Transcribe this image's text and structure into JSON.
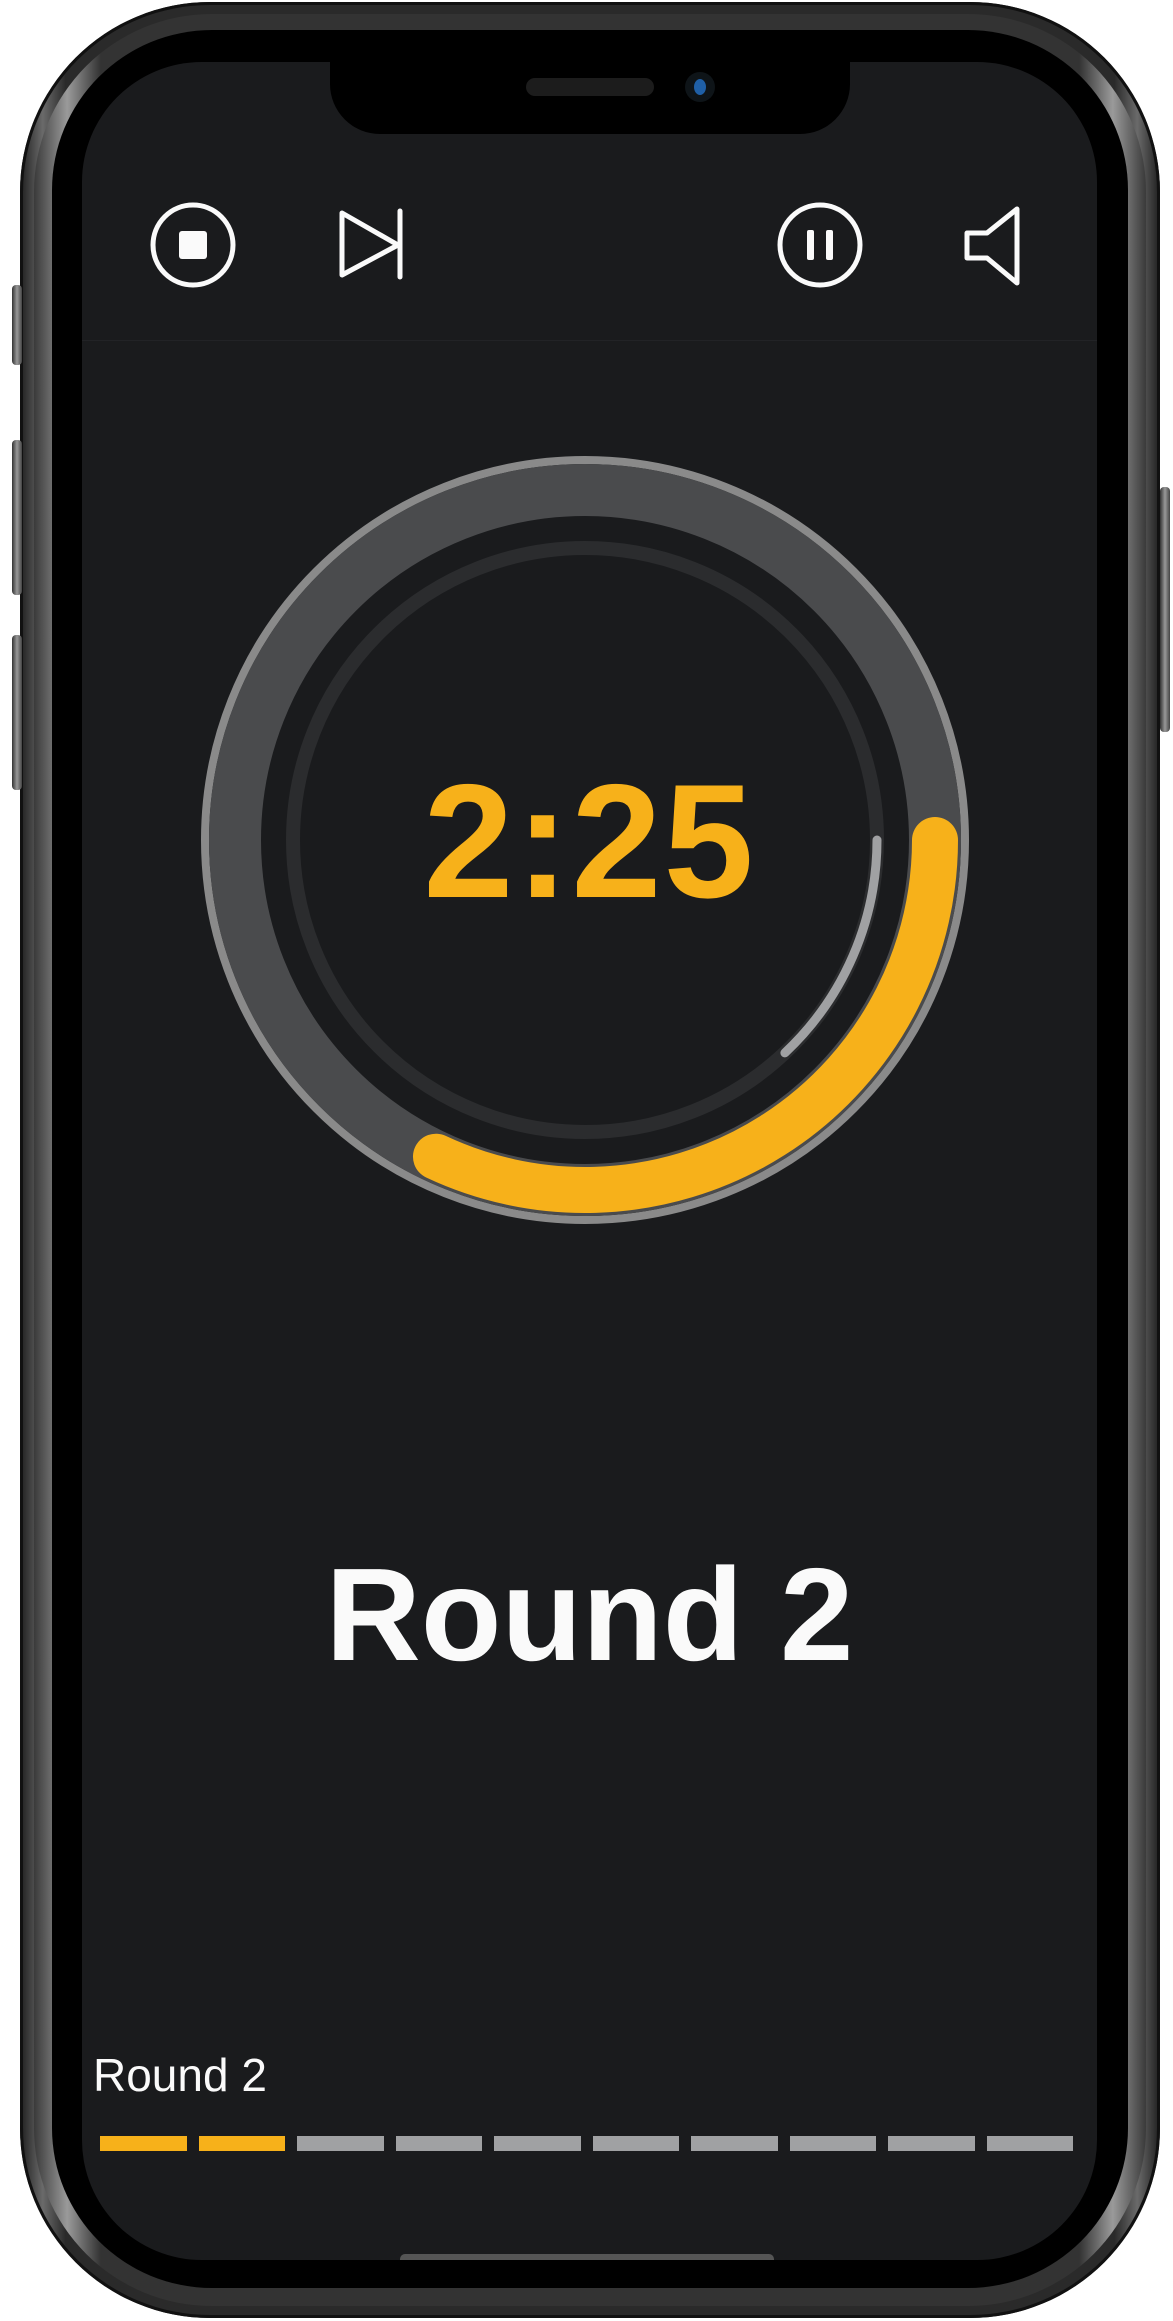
{
  "toolbar": {
    "stop_label": "Stop",
    "skip_label": "Skip",
    "pause_label": "Pause",
    "sound_label": "Sound"
  },
  "icons": {
    "stop": "stop-circle-icon",
    "skip": "skip-forward-icon",
    "pause": "pause-circle-icon",
    "sound": "speaker-icon"
  },
  "timer": {
    "time": "2:25",
    "outer_progress_fraction": 0.32,
    "inner_progress_fraction": 0.13
  },
  "round": {
    "title": "Round 2",
    "label": "Round 2",
    "current": 2,
    "total": 10
  },
  "colors": {
    "accent": "#f7b11a",
    "background": "#1a1b1d",
    "ring_track": "#4a4b4d",
    "ring_border": "#8a8a8a",
    "inner_ring": "#2b2c2e",
    "inner_progress": "#a0a1a3",
    "segment_inactive": "#a0a1a3",
    "text": "#fafafa"
  }
}
